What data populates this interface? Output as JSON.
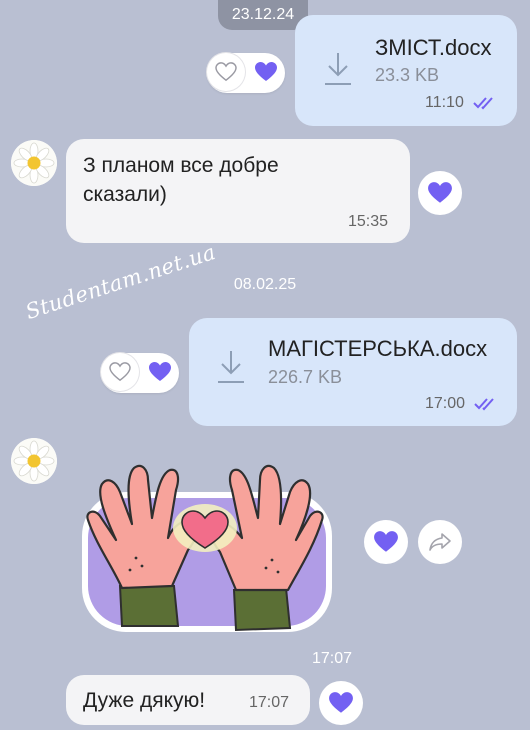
{
  "dates": {
    "top": "23.12.24",
    "middle": "08.02.25",
    "bottom": "17:07"
  },
  "messages": [
    {
      "type": "file",
      "direction": "out",
      "file_name": "ЗМІСТ.docx",
      "file_size": "23.3 KB",
      "time": "11:10",
      "status": "read"
    },
    {
      "type": "text",
      "direction": "in",
      "text_line1": "З планом все добре",
      "text_line2": "сказали)",
      "time": "15:35"
    },
    {
      "type": "file",
      "direction": "out",
      "file_name": "МАГІСТЕРСЬКА.docx",
      "file_size": "226.7 KB",
      "time": "17:00",
      "status": "read"
    },
    {
      "type": "sticker",
      "direction": "in",
      "sticker": "hands-heart-sticker"
    },
    {
      "type": "text",
      "direction": "in",
      "text": "Дуже дякую!",
      "time": "17:07"
    }
  ],
  "watermark": "Studentam.net.ua",
  "icons": [
    "download-icon",
    "heart-outline-icon",
    "heart-filled-icon",
    "double-check-icon",
    "forward-icon",
    "daisy-avatar"
  ],
  "colors": {
    "background": "#b9bfd2",
    "outgoing": "#d8e6fa",
    "incoming": "#f4f4f6",
    "accent": "#7360f2",
    "date_pill": "#8e93a3"
  }
}
